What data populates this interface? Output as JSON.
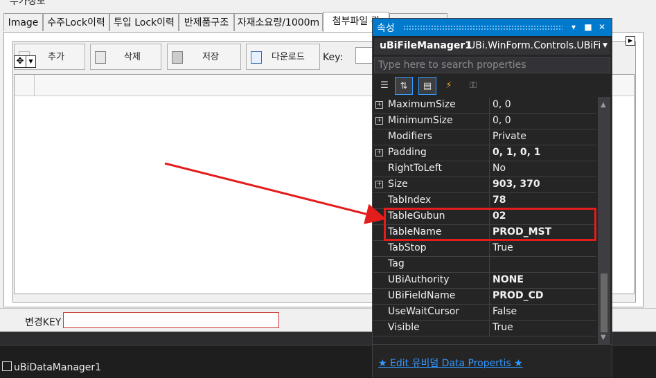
{
  "form": {
    "group_title": "부가정보",
    "tabs": [
      {
        "label": "Image"
      },
      {
        "label": "수주Lock이력"
      },
      {
        "label": "투입 Lock이력"
      },
      {
        "label": "반제품구조"
      },
      {
        "label": "자재소요량/1000m"
      },
      {
        "label": "첨부파일 관"
      }
    ],
    "toolbar": {
      "add_label": "추가",
      "delete_label": "삭제",
      "save_label": "저장",
      "download_label": "다운로드",
      "key_label": "Key:"
    },
    "change_key_label": "변경KEY"
  },
  "component_tray": {
    "items": [
      {
        "label": "uBiDataManager1"
      }
    ]
  },
  "properties": {
    "title": "속성",
    "object_name": "uBiFileManager1",
    "object_type": "UBi.WinForm.Controls.UBiFil",
    "search_placeholder": "Type here to search properties",
    "rows": [
      {
        "name": "MaximumSize",
        "value": "0, 0",
        "expandable": true,
        "bold": false
      },
      {
        "name": "MinimumSize",
        "value": "0, 0",
        "expandable": true,
        "bold": false
      },
      {
        "name": "Modifiers",
        "value": "Private",
        "expandable": false,
        "bold": false
      },
      {
        "name": "Padding",
        "value": "0, 1, 0, 1",
        "expandable": true,
        "bold": true
      },
      {
        "name": "RightToLeft",
        "value": "No",
        "expandable": false,
        "bold": false
      },
      {
        "name": "Size",
        "value": "903, 370",
        "expandable": true,
        "bold": true
      },
      {
        "name": "TabIndex",
        "value": "78",
        "expandable": false,
        "bold": true
      },
      {
        "name": "TableGubun",
        "value": "02",
        "expandable": false,
        "bold": true
      },
      {
        "name": "TableName",
        "value": "PROD_MST",
        "expandable": false,
        "bold": true
      },
      {
        "name": "TabStop",
        "value": "True",
        "expandable": false,
        "bold": false
      },
      {
        "name": "Tag",
        "value": "",
        "expandable": false,
        "bold": false
      },
      {
        "name": "UBiAuthority",
        "value": "NONE",
        "expandable": false,
        "bold": true
      },
      {
        "name": "UBiFieldName",
        "value": "PROD_CD",
        "expandable": false,
        "bold": true
      },
      {
        "name": "UseWaitCursor",
        "value": "False",
        "expandable": false,
        "bold": false
      },
      {
        "name": "Visible",
        "value": "True",
        "expandable": false,
        "bold": false
      }
    ],
    "footer_link": "★ Edit 유비덤 Data Propertis ★",
    "scroll_position": 0.78
  },
  "colors": {
    "accent": "#007acc",
    "highlight": "#e31c1c",
    "link": "#3399ff"
  }
}
